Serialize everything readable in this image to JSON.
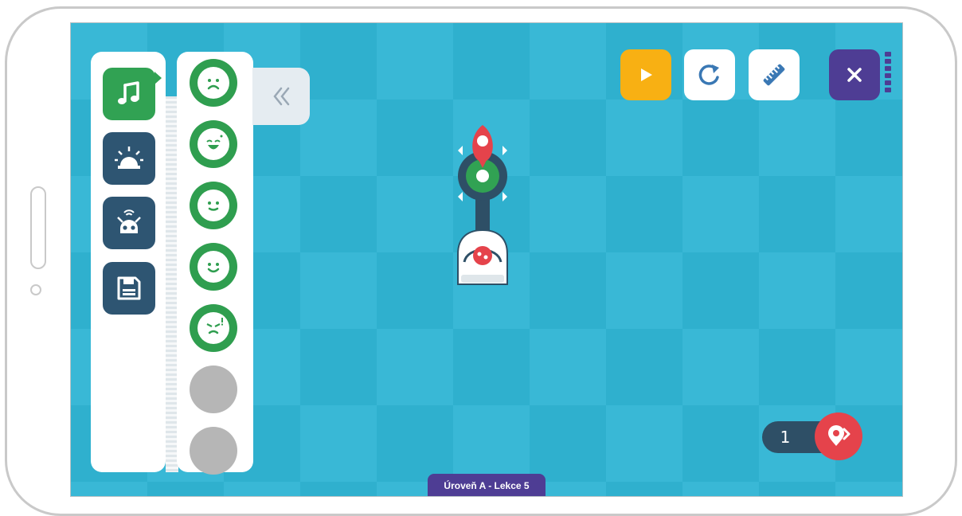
{
  "screen": {
    "colors": {
      "board_light": "#39b8d6",
      "board_dark": "#2fb0ce",
      "panel": "#ffffff",
      "category_active": "#31a253",
      "category_inactive": "#2e5572",
      "sound_item": "#2f9e4f",
      "empty_item": "#b6b6b6",
      "play": "#f8b013",
      "close": "#4e3d94",
      "counter": "#2e4f66",
      "marker_red": "#e5434b"
    }
  },
  "sidebar": {
    "categories": [
      {
        "icon": "music-note-icon",
        "state": "active"
      },
      {
        "icon": "siren-light-icon"
      },
      {
        "icon": "robot-signal-icon"
      },
      {
        "icon": "save-disk-icon"
      }
    ]
  },
  "items": [
    {
      "icon": "sad-face-icon"
    },
    {
      "icon": "laughing-face-icon"
    },
    {
      "icon": "neutral-face-icon"
    },
    {
      "icon": "smiling-face-icon"
    },
    {
      "icon": "angry-face-icon"
    },
    {
      "icon": "empty-slot"
    },
    {
      "icon": "empty-slot"
    }
  ],
  "collapse": {
    "icon": "double-chevron-left-icon"
  },
  "toolbar": {
    "play": {
      "icon": "play-icon"
    },
    "reset": {
      "icon": "reset-arrow-icon"
    },
    "measure": {
      "icon": "ruler-icon"
    },
    "close": {
      "icon": "close-icon"
    },
    "battery_level": 1.0
  },
  "board": {
    "robot": {
      "icon": "ozobot-robot-icon"
    },
    "target_marker": {
      "icon": "location-pin-icon"
    },
    "path_node": {
      "icon": "sound-node-icon"
    }
  },
  "counter": {
    "value": "1",
    "button_icon": "pin-arrow-icon"
  },
  "level": {
    "label": "Úroveň A - Lekce 5"
  }
}
